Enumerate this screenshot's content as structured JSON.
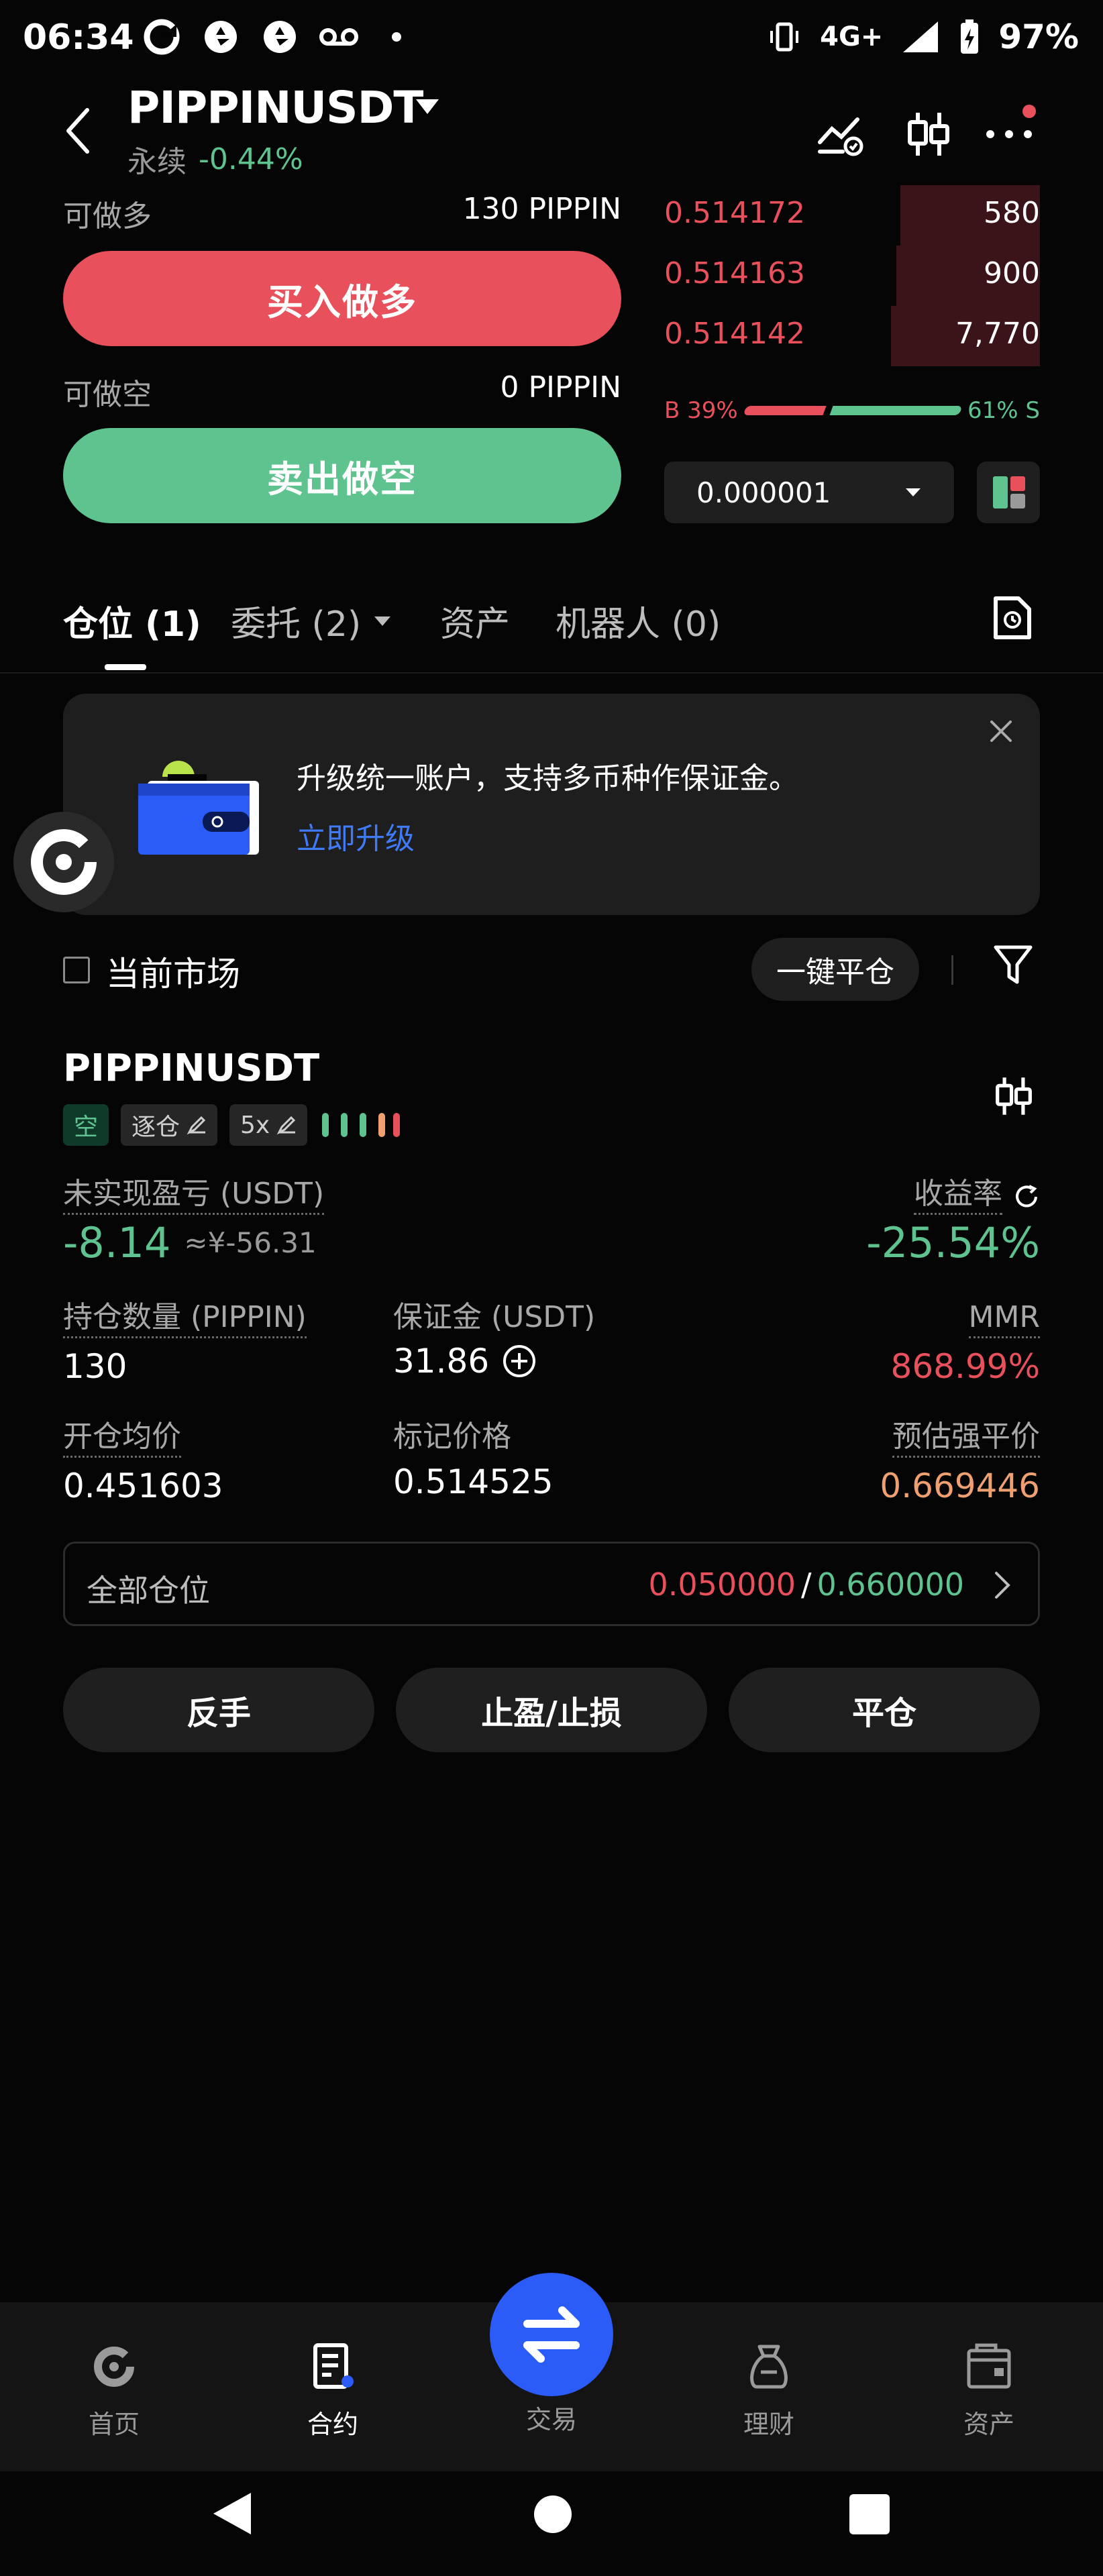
{
  "status_bar": {
    "time": "06:34",
    "network": "4G+",
    "battery": "97%",
    "icons": [
      "app-logo-icon",
      "aperture-icon",
      "aperture-icon",
      "voicemail-icon",
      "dot-icon",
      "vibrate-icon",
      "signal-icon",
      "battery-charging-icon"
    ]
  },
  "header": {
    "pair": "PIPPINUSDT",
    "contract_type": "永续",
    "change": "-0.44%"
  },
  "order_panel": {
    "long_label": "可做多",
    "long_amount": "130 PIPPIN",
    "buy_long_label": "买入做多",
    "short_label": "可做空",
    "short_amount": "0 PIPPIN",
    "sell_short_label": "卖出做空"
  },
  "order_book": {
    "asks": [
      {
        "price": "0.514172",
        "qty": "580",
        "depth": 0.15
      },
      {
        "price": "0.514163",
        "qty": "900",
        "depth": 0.16
      },
      {
        "price": "0.514142",
        "qty": "7,770",
        "depth": 0.17
      }
    ],
    "buy_ratio_label": "B 39%",
    "sell_ratio_label": "61% S",
    "buy_ratio": 0.39,
    "precision": "0.000001"
  },
  "tabs": [
    {
      "label": "仓位 (1)",
      "active": true
    },
    {
      "label": "委托 (2)",
      "active": false
    },
    {
      "label": "资产",
      "active": false
    },
    {
      "label": "机器人 (0)",
      "active": false
    }
  ],
  "banner": {
    "text": "升级统一账户，支持多币种作保证金。",
    "link": "立即升级"
  },
  "filter": {
    "current_market_label": "当前市场",
    "close_all_label": "一键平仓"
  },
  "position": {
    "symbol": "PIPPINUSDT",
    "side_tag": "空",
    "margin_mode_tag": "逐仓",
    "leverage_tag": "5x",
    "unrealized_pnl_label": "未实现盈亏 (USDT)",
    "unrealized_pnl": "-8.14",
    "unrealized_pnl_cny": "≈¥-56.31",
    "roe_label": "收益率",
    "roe": "-25.54%",
    "size_label": "持仓数量 (PIPPIN)",
    "size": "130",
    "margin_label": "保证金 (USDT)",
    "margin": "31.86",
    "mmr_label": "MMR",
    "mmr": "868.99%",
    "entry_label": "开仓均价",
    "entry": "0.451603",
    "mark_label": "标记价格",
    "mark": "0.514525",
    "liq_label": "预估强平价",
    "liq": "0.669446",
    "tpsl_label": "全部仓位",
    "tp_value": "0.050000",
    "tpsl_sep": "/",
    "sl_value": "0.660000",
    "reverse_label": "反手",
    "tpsl_button_label": "止盈/止损",
    "close_label": "平仓"
  },
  "bottom_nav": [
    {
      "label": "首页",
      "icon": "home-icon"
    },
    {
      "label": "合约",
      "icon": "contract-icon",
      "active": true
    },
    {
      "label": "交易",
      "icon": "swap-icon"
    },
    {
      "label": "理财",
      "icon": "finance-icon"
    },
    {
      "label": "资产",
      "icon": "wallet-icon"
    }
  ],
  "colors": {
    "red": "#e8505b",
    "green": "#5ec38f",
    "blue": "#2b5cf7",
    "orange": "#f0a070"
  }
}
